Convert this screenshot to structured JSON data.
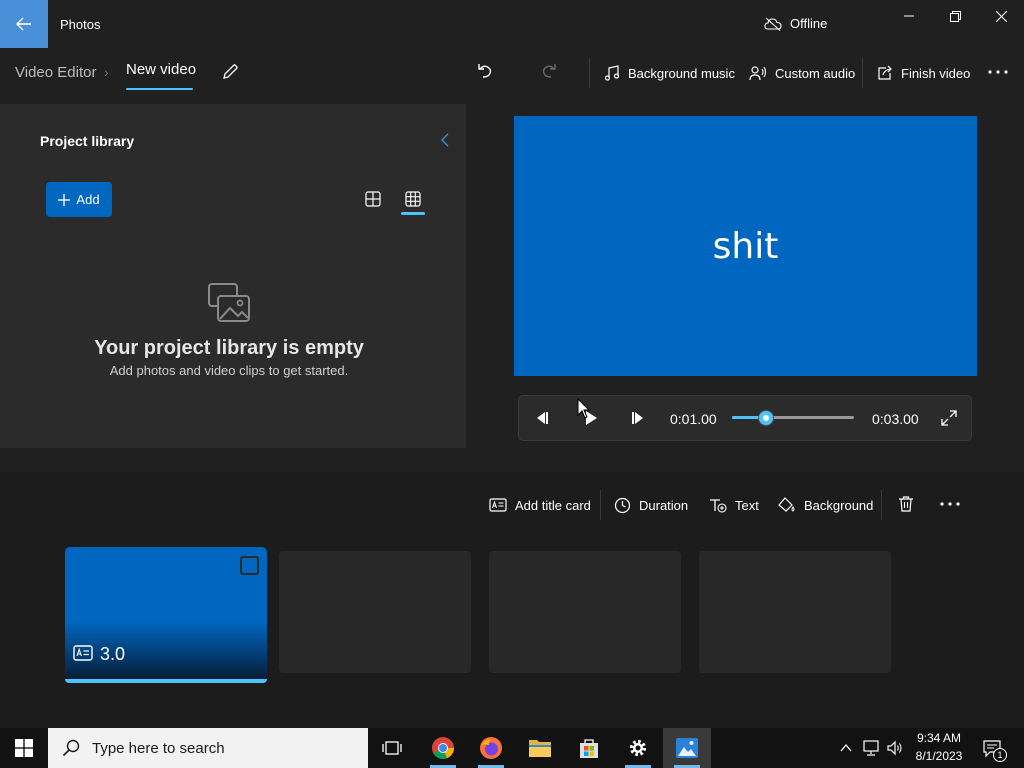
{
  "titlebar": {
    "app_title": "Photos",
    "offline_label": "Offline"
  },
  "toolbar": {
    "breadcrumb_parent": "Video Editor",
    "breadcrumb_current": "New video",
    "background_music_label": "Background music",
    "custom_audio_label": "Custom audio",
    "finish_video_label": "Finish video"
  },
  "library": {
    "title": "Project library",
    "add_label": "Add",
    "empty_title": "Your project library is empty",
    "empty_subtitle": "Add photos and video clips to get started."
  },
  "preview": {
    "text": "shit",
    "current_time": "0:01.00",
    "total_time": "0:03.00",
    "progress": 0.28
  },
  "storyboard": {
    "add_title_card_label": "Add title card",
    "duration_label": "Duration",
    "text_label": "Text",
    "background_label": "Background",
    "clips": [
      {
        "duration": "3.0",
        "selected": true
      }
    ]
  },
  "taskbar": {
    "search_placeholder": "Type here to search",
    "time": "9:34 AM",
    "date": "8/1/2023",
    "notification_count": "1"
  },
  "colors": {
    "accent": "#4cc2ff",
    "preview_background": "#0067c0",
    "back_button": "#4a90d9"
  }
}
